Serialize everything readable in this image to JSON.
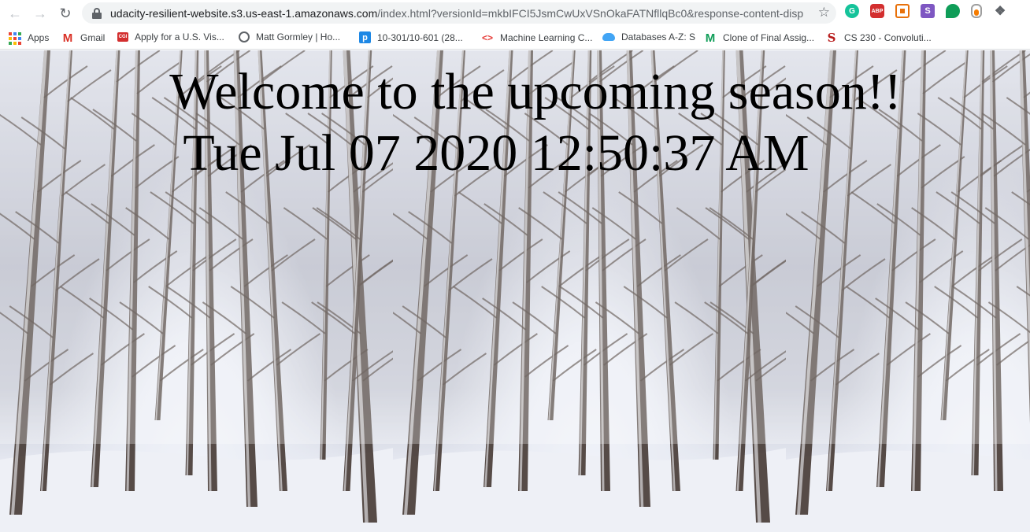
{
  "browser": {
    "url_host": "udacity-resilient-website.s3.us-east-1.amazonaws.com",
    "url_rest": "/index.html?versionId=mkbIFCI5JsmCwUxVSnOkaFATNfllqBc0&response-content-dispo...",
    "extensions": [
      "grammarly-icon",
      "adblock-plus-icon",
      "orange-square-icon",
      "s-extension-icon",
      "green-leaf-icon",
      "jar-icon",
      "puzzle-icon",
      "profile-avatar"
    ]
  },
  "bookmarks": [
    {
      "label": "Apps",
      "icon": "apps-grid-icon"
    },
    {
      "label": "Gmail",
      "icon": "gmail-icon"
    },
    {
      "label": "Apply for a U.S. Vis...",
      "icon": "cgi-icon"
    },
    {
      "label": "Matt Gormley | Ho...",
      "icon": "globe-icon"
    },
    {
      "label": "10-301/10-601 (28...",
      "icon": "piazza-icon"
    },
    {
      "label": "Machine Learning C...",
      "icon": "code-icon"
    },
    {
      "label": "Databases A-Z: S",
      "icon": "cloud-icon"
    },
    {
      "label": "Clone of Final Assig...",
      "icon": "m-icon"
    },
    {
      "label": "CS 230 - Convoluti...",
      "icon": "stanford-icon"
    }
  ],
  "page": {
    "title": "Welcome to the upcoming season!!",
    "datetime": "Tue Jul 07 2020 12:50:37 AM"
  },
  "colors": {
    "snow": "#eef0f6",
    "bark": "#3b2e28",
    "sky": "#c9ccd8"
  }
}
